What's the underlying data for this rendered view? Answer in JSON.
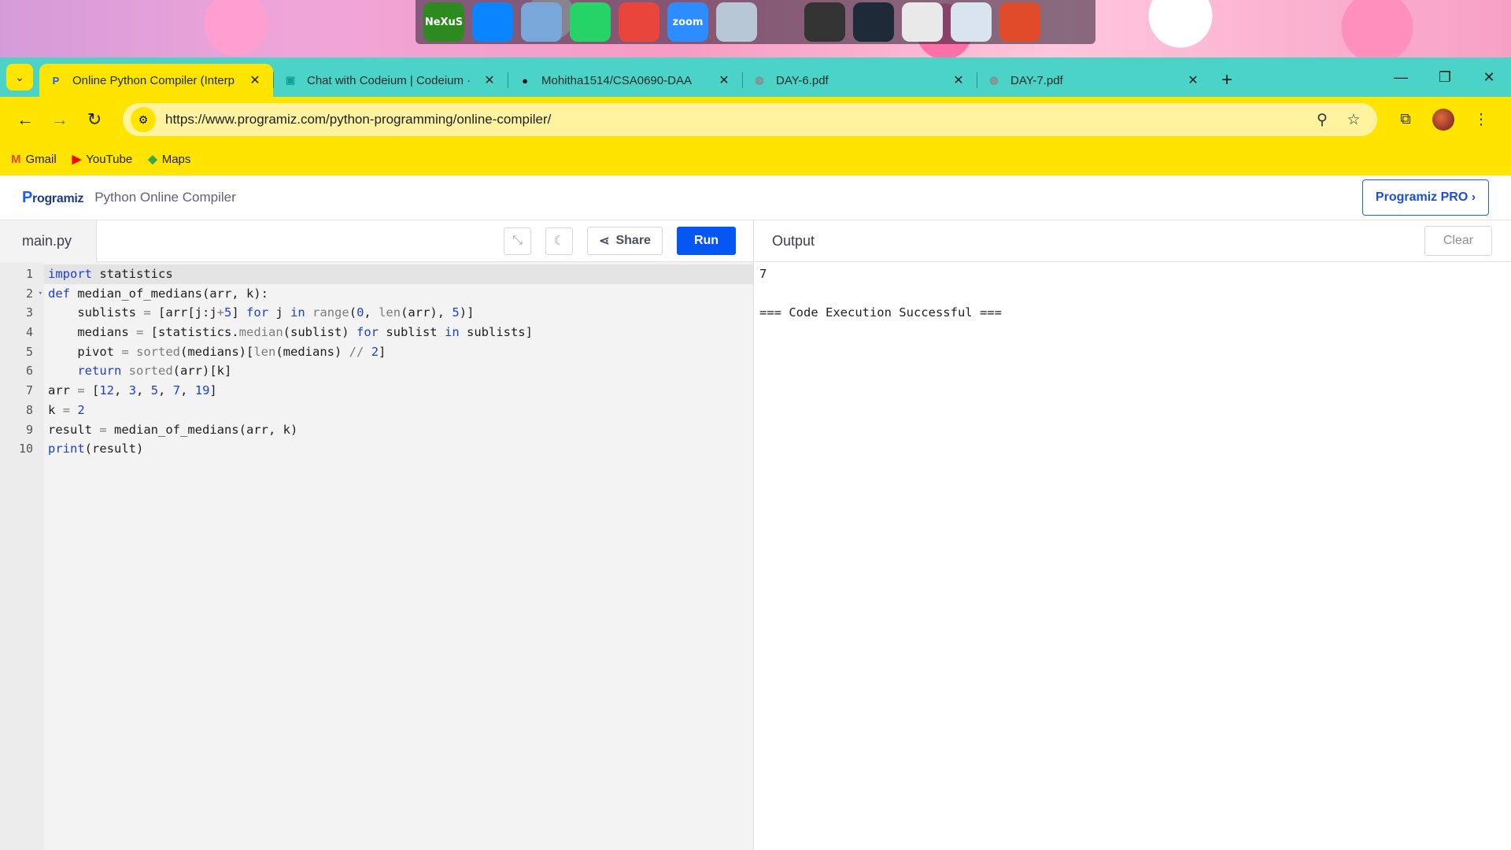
{
  "dock": {
    "items": [
      {
        "name": "nexus-icon",
        "label": "NeXuS",
        "color": "#2d8a1f"
      },
      {
        "name": "windows-icon",
        "label": "",
        "color": "#0a84ff"
      },
      {
        "name": "computer-icon",
        "label": "",
        "color": "#7aa7d9"
      },
      {
        "name": "whatsapp-icon",
        "label": "",
        "color": "#25d366"
      },
      {
        "name": "chrome-icon",
        "label": "",
        "color": "#e8453c"
      },
      {
        "name": "zoom-icon",
        "label": "zoom",
        "color": "#2d8cff"
      },
      {
        "name": "recycle-bin-icon",
        "label": "",
        "color": "#b8c7d6"
      },
      {
        "name": "speaker-icon",
        "label": "",
        "color": "#333333"
      },
      {
        "name": "camera-icon",
        "label": "",
        "color": "#1d2a38"
      },
      {
        "name": "clock-icon",
        "label": "",
        "color": "#e9e9e9"
      },
      {
        "name": "monitor-moon-icon",
        "label": "",
        "color": "#d9e4ef"
      },
      {
        "name": "power-icon",
        "label": "",
        "color": "#e04b2a"
      }
    ]
  },
  "tabs": [
    {
      "title": "Online Python Compiler (Interp",
      "active": true,
      "favicon": "P",
      "favicon_color": "#1a5cff"
    },
    {
      "title": "Chat with Codeium | Codeium ·",
      "active": false,
      "favicon": "▣",
      "favicon_color": "#0e9f8f"
    },
    {
      "title": "Mohitha1514/CSA0690-DAA",
      "active": false,
      "favicon": "●",
      "favicon_color": "#111111"
    },
    {
      "title": "DAY-6.pdf",
      "active": false,
      "favicon": "◍",
      "favicon_color": "#8a8a8a"
    },
    {
      "title": "DAY-7.pdf",
      "active": false,
      "favicon": "◍",
      "favicon_color": "#8a8a8a"
    }
  ],
  "toolbar": {
    "url": "https://www.programiz.com/python-programming/online-compiler/"
  },
  "bookmarks": [
    {
      "label": "Gmail",
      "icon": "M",
      "color": "#ea4335"
    },
    {
      "label": "YouTube",
      "icon": "▶",
      "color": "#ff0000"
    },
    {
      "label": "Maps",
      "icon": "◆",
      "color": "#34a853"
    }
  ],
  "header": {
    "logo": "rogramiz",
    "logo_initial": "P",
    "subtitle": "Python Online Compiler",
    "pro_button": "Programiz PRO ›"
  },
  "editor": {
    "filename": "main.py",
    "share_label": "Share",
    "run_label": "Run",
    "lines": [
      "import statistics",
      "def median_of_medians(arr, k):",
      "    sublists = [arr[j:j+5] for j in range(0, len(arr), 5)]",
      "    medians = [statistics.median(sublist) for sublist in sublists]",
      "    pivot = sorted(medians)[len(medians) // 2]",
      "    return sorted(arr)[k]",
      "arr = [12, 3, 5, 7, 19]",
      "k = 2",
      "result = median_of_medians(arr, k)",
      "print(result)"
    ],
    "line_numbers": [
      "1",
      "2",
      "3",
      "4",
      "5",
      "6",
      "7",
      "8",
      "9",
      "10"
    ]
  },
  "output": {
    "title": "Output",
    "clear_label": "Clear",
    "lines": [
      "7",
      "",
      "=== Code Execution Successful ==="
    ]
  },
  "colors": {
    "accent": "#0556f3",
    "tabstrip": "#4cd3c8",
    "toolbar": "#ffe400"
  }
}
